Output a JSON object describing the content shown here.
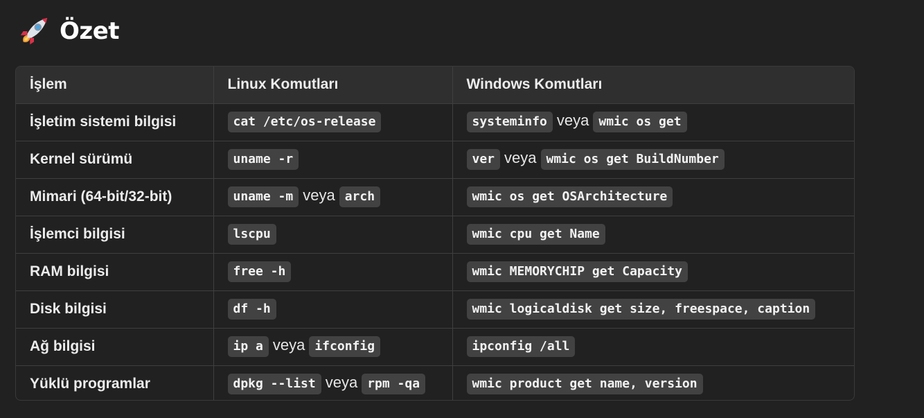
{
  "heading": {
    "icon": "rocket-icon",
    "title": "Özet"
  },
  "table": {
    "headers": [
      "İşlem",
      "Linux Komutları",
      "Windows Komutları"
    ],
    "rows": [
      {
        "label": "İşletim sistemi bilgisi",
        "linux": [
          "cat /etc/os-release"
        ],
        "windows": [
          "systeminfo",
          "wmic os get"
        ]
      },
      {
        "label": "Kernel sürümü",
        "linux": [
          "uname -r"
        ],
        "windows": [
          "ver",
          "wmic os get BuildNumber"
        ]
      },
      {
        "label": "Mimari (64-bit/32-bit)",
        "linux": [
          "uname -m",
          "arch"
        ],
        "windows": [
          "wmic os get OSArchitecture"
        ]
      },
      {
        "label": "İşlemci bilgisi",
        "linux": [
          "lscpu"
        ],
        "windows": [
          "wmic cpu get Name"
        ]
      },
      {
        "label": "RAM bilgisi",
        "linux": [
          "free -h"
        ],
        "windows": [
          "wmic MEMORYCHIP get Capacity"
        ]
      },
      {
        "label": "Disk bilgisi",
        "linux": [
          "df -h"
        ],
        "windows": [
          "wmic logicaldisk get size, freespace, caption"
        ]
      },
      {
        "label": "Ağ bilgisi",
        "linux": [
          "ip a",
          "ifconfig"
        ],
        "windows": [
          "ipconfig /all"
        ]
      },
      {
        "label": "Yüklü programlar",
        "linux": [
          "dpkg --list",
          "rpm -qa"
        ],
        "windows": [
          "wmic product get name, version"
        ]
      }
    ],
    "separator": "veya"
  },
  "colors": {
    "background": "#212121",
    "header_row": "#2f2f2f",
    "code_bg": "#424242",
    "border": "#3f3f3f"
  }
}
